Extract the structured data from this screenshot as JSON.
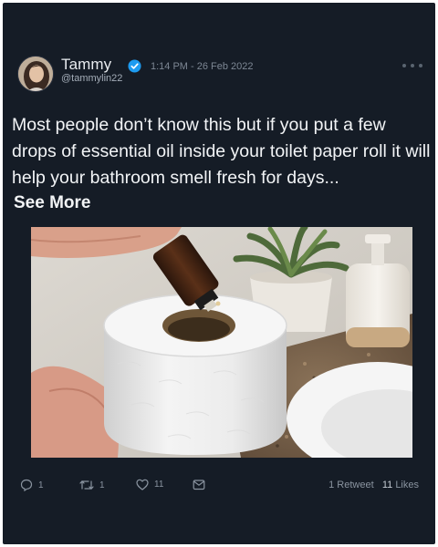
{
  "tweet": {
    "author_name": "Tammy",
    "author_handle": "@tammylin22",
    "timestamp": "1:14 PM - 26 Feb 2022",
    "text": "Most people don’t know this but if you put a few drops of essential oil inside your toilet paper roll it will help your bathroom smell fresh for days...",
    "see_more_label": "See More"
  },
  "actions": {
    "reply_count": "1",
    "retweet_count": "1",
    "like_count": "11"
  },
  "stats": {
    "retweets_count": "1",
    "retweets_label": "Retweet",
    "likes_count": "11",
    "likes_label": "Likes"
  },
  "colors": {
    "background": "#151c26",
    "verified": "#1d9bf0"
  },
  "icons": [
    "verified-badge-icon",
    "more-icon",
    "reply-icon",
    "retweet-icon",
    "like-icon",
    "share-icon"
  ]
}
